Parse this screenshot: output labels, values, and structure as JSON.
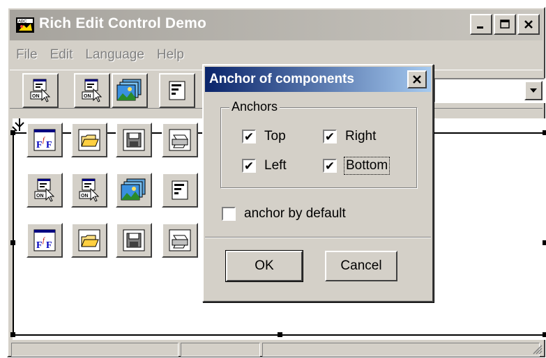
{
  "window": {
    "title": "Rich Edit Control Demo",
    "caption_buttons": [
      "minimize",
      "maximize",
      "close"
    ]
  },
  "menu": {
    "items": [
      "File",
      "Edit",
      "Language",
      "Help"
    ]
  },
  "toolbar": {
    "icons": [
      "component-on-icon",
      "component-on-icon",
      "image-stack-icon",
      "text-align-icon"
    ]
  },
  "editor": {
    "rows": [
      [
        "font-icon",
        "folder-open-icon",
        "save-icon",
        "print-icon"
      ],
      [
        "component-on-icon",
        "component-on-icon",
        "image-stack-icon",
        "text-align-icon"
      ],
      [
        "font-icon",
        "folder-open-icon",
        "save-icon",
        "print-icon"
      ]
    ]
  },
  "dialog": {
    "title": "Anchor of components",
    "group_label": "Anchors",
    "anchors": {
      "top": {
        "label": "Top",
        "checked": true
      },
      "right": {
        "label": "Right",
        "checked": true
      },
      "left": {
        "label": "Left",
        "checked": true
      },
      "bottom": {
        "label": "Bottom",
        "checked": true
      }
    },
    "anchor_by_default": {
      "label": "anchor by default",
      "checked": false
    },
    "ok_label": "OK",
    "cancel_label": "Cancel"
  },
  "colors": {
    "dialog_title_start": "#0a246a",
    "dialog_title_end": "#a6caf0",
    "face": "#d4d0c8"
  }
}
